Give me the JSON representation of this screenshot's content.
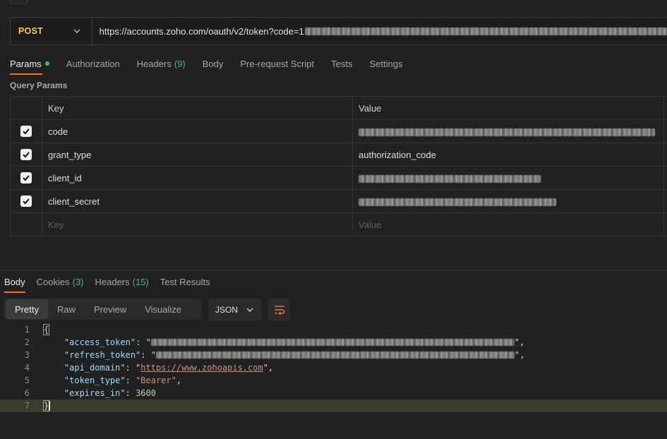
{
  "request": {
    "method": "POST",
    "url_prefix": "https://accounts.zoho.com/oauth/v2/token?code=1"
  },
  "request_tabs": [
    {
      "label": "Params",
      "active": true,
      "dot": true
    },
    {
      "label": "Authorization"
    },
    {
      "label": "Headers",
      "count": "(9)"
    },
    {
      "label": "Body"
    },
    {
      "label": "Pre-request Script"
    },
    {
      "label": "Tests"
    },
    {
      "label": "Settings"
    }
  ],
  "query_params_title": "Query Params",
  "params_table": {
    "headers": [
      "Key",
      "Value"
    ],
    "rows": [
      {
        "key": "code",
        "value": "",
        "checked": true
      },
      {
        "key": "grant_type",
        "value": "authorization_code",
        "checked": true
      },
      {
        "key": "client_id",
        "value": "",
        "checked": true
      },
      {
        "key": "client_secret",
        "value": "",
        "checked": true
      }
    ],
    "placeholder_key": "Key",
    "placeholder_value": "Value"
  },
  "response_tabs": [
    {
      "label": "Body",
      "active": true
    },
    {
      "label": "Cookies",
      "count": "(3)"
    },
    {
      "label": "Headers",
      "count": "(15)"
    },
    {
      "label": "Test Results"
    }
  ],
  "view_modes": [
    "Pretty",
    "Raw",
    "Preview",
    "Visualize"
  ],
  "format": "JSON",
  "response_lines": {
    "numbers": [
      "1",
      "2",
      "3",
      "4",
      "5",
      "6",
      "7"
    ],
    "open_brace": "{",
    "close_brace": "}",
    "access_token_key": "\"access_token\"",
    "refresh_token_key": "\"refresh_token\"",
    "api_domain_key": "\"api_domain\"",
    "api_domain_value": "https://www.zohoapis.com",
    "token_type_key": "\"token_type\"",
    "token_type_value": "\"Bearer\"",
    "expires_in_key": "\"expires_in\"",
    "expires_in_value": "3600"
  },
  "colors": {
    "accent": "#ff6c37",
    "method": "#f2c94c",
    "count": "#56b36a",
    "dot": "#34c759"
  }
}
